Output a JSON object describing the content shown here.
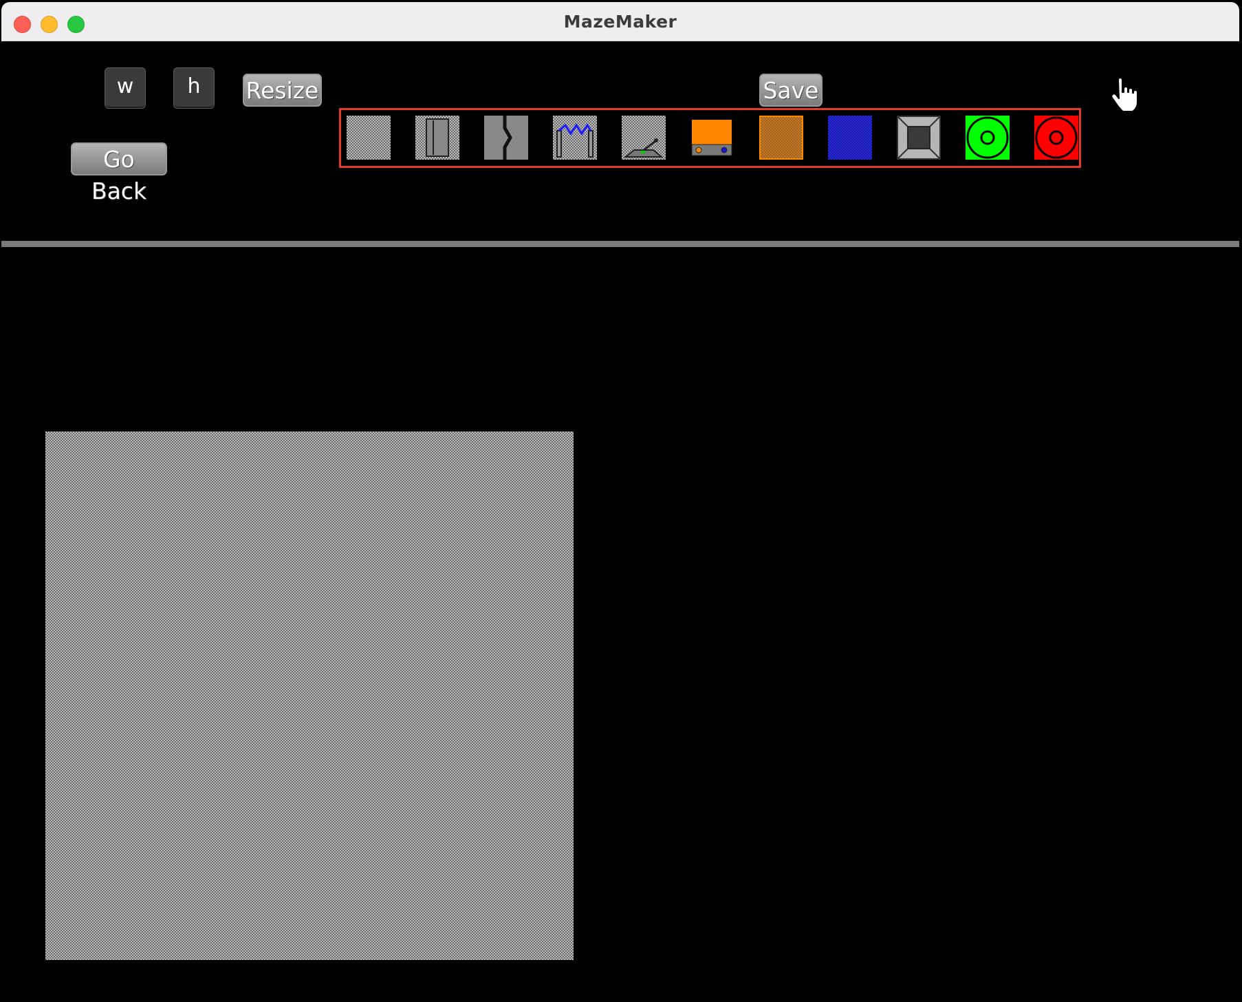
{
  "window": {
    "title": "MazeMaker"
  },
  "controls": {
    "width_field": "w",
    "height_field": "h",
    "resize_label": "Resize",
    "go_back_label": "Go Back",
    "save_label": "Save"
  },
  "palette": {
    "tiles": [
      "floor-tile-icon",
      "door-tile-icon",
      "cracked-wall-tile-icon",
      "electric-fence-tile-icon",
      "lever-tile-icon",
      "control-panel-tile-icon",
      "dirt-tile-icon",
      "water-tile-icon",
      "wall-block-tile-icon",
      "start-target-tile-icon",
      "end-target-tile-icon"
    ],
    "border_color": "#e23b2b"
  },
  "colors": {
    "traffic_close": "#fe5f57",
    "traffic_minimize": "#febc2e",
    "traffic_maximize": "#28c840",
    "orange": "#ff8800",
    "green": "#00ff00",
    "red": "#ff0000",
    "blue": "#2020c0"
  }
}
